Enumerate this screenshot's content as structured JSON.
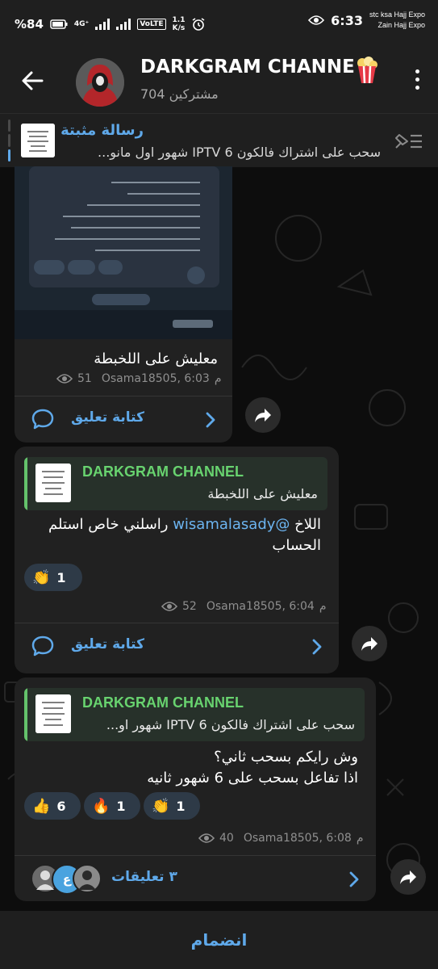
{
  "status_bar": {
    "battery": "%84",
    "network": "4G⁺",
    "volte": "VoLTE",
    "speed_value": "1.1",
    "speed_unit": "K/s",
    "time": "6:33",
    "carrier_1": "stc ksa Hajj Expo",
    "carrier_2": "Zain Hajj Expo"
  },
  "header": {
    "title": "DARKGRAM CHANNE",
    "subscribers": "704 مشتركين"
  },
  "pinned": {
    "title": "رسالة مثبتة",
    "text": "سحب على اشتراك فالكون 6 IPTV شهور اول مانو..."
  },
  "messages": [
    {
      "caption": "معليش على اللخبطة",
      "views": "51",
      "author_time": "Osama18505, 6:03",
      "time_suffix": "م",
      "comment_label": "كتابة تعليق"
    },
    {
      "reply_name": "DARKGRAM CHANNEL",
      "reply_text": "معليش على اللخبطة",
      "text_prefix": "اللاخ ",
      "mention": "@wisamalasady",
      "text_suffix": " راسلني خاص استلم الحساب",
      "reactions": [
        {
          "emoji": "👏",
          "count": "1"
        }
      ],
      "views": "52",
      "author_time": "Osama18505, 6:04",
      "time_suffix": "م",
      "comment_label": "كتابة تعليق"
    },
    {
      "reply_name": "DARKGRAM CHANNEL",
      "reply_text": "سحب على اشتراك فالكون 6 IPTV شهور او...",
      "line_1": "وش رايكم بسحب ثاني؟",
      "line_2": "اذا تفاعل بسحب على 6 شهور ثانيه",
      "reactions": [
        {
          "emoji": "👏",
          "count": "1"
        },
        {
          "emoji": "🔥",
          "count": "1"
        },
        {
          "emoji": "👍",
          "count": "6"
        }
      ],
      "views": "40",
      "author_time": "Osama18505, 6:08",
      "time_suffix": "م",
      "comments_label": "٣ تعليقات",
      "commenter_badge": "ع"
    }
  ],
  "join_label": "انضمام",
  "colors": {
    "accent": "#5fa9ea",
    "reply_name": "#68d36f",
    "bubble": "#212121",
    "background": "#0d0d0d"
  }
}
